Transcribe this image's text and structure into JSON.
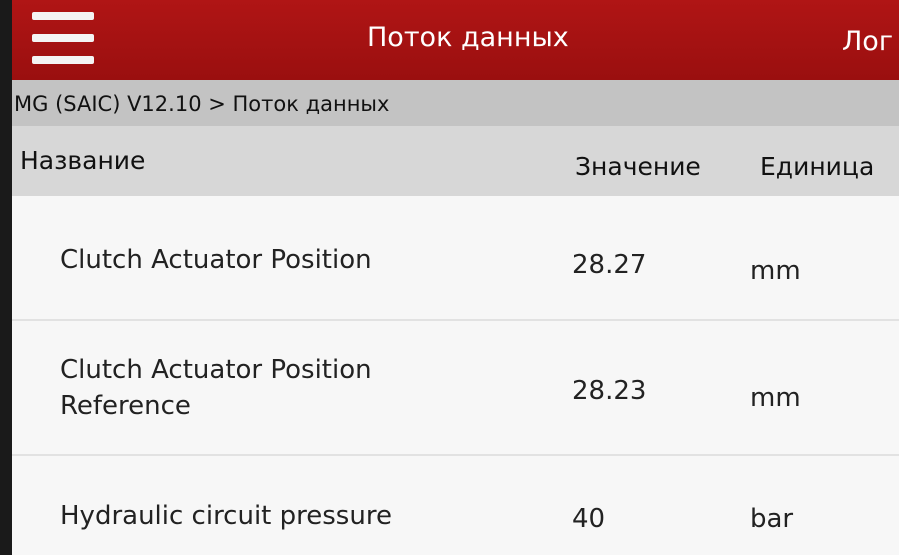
{
  "header": {
    "title": "Поток данных",
    "log_label": "Лог"
  },
  "breadcrumb": "MG (SAIC) V12.10 > Поток данных",
  "columns": {
    "name": "Название",
    "value": "Значение",
    "unit": "Единица"
  },
  "rows": [
    {
      "name": "Clutch Actuator Position",
      "value": "28.27",
      "unit": "mm"
    },
    {
      "name": "Clutch Actuator Position Reference",
      "value": "28.23",
      "unit": "mm"
    },
    {
      "name": "Hydraulic circuit pressure",
      "value": "40",
      "unit": "bar"
    }
  ],
  "colors": {
    "titlebar": "#a41212",
    "breadcrumb_bg": "#c3c3c3",
    "header_bg": "#d7d7d7",
    "row_bg": "#f7f7f7"
  }
}
